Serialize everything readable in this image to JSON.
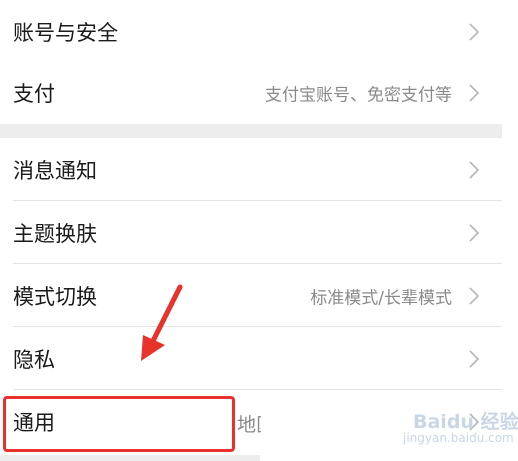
{
  "settings": {
    "group1": [
      {
        "label": "账号与安全",
        "value": ""
      },
      {
        "label": "支付",
        "value": "支付宝账号、免密支付等"
      }
    ],
    "group2": [
      {
        "label": "消息通知",
        "value": ""
      },
      {
        "label": "主题换肤",
        "value": ""
      },
      {
        "label": "模式切换",
        "value": "标准模式/长辈模式"
      },
      {
        "label": "隐私",
        "value": ""
      },
      {
        "label": "通用",
        "value": "地区"
      }
    ]
  },
  "annotation": {
    "highlight_color": "#e8322c",
    "arrow_icon": "red-arrow-icon"
  },
  "watermark": {
    "brand": "Baidu 经验",
    "url": "jingyan.baidu.com"
  }
}
